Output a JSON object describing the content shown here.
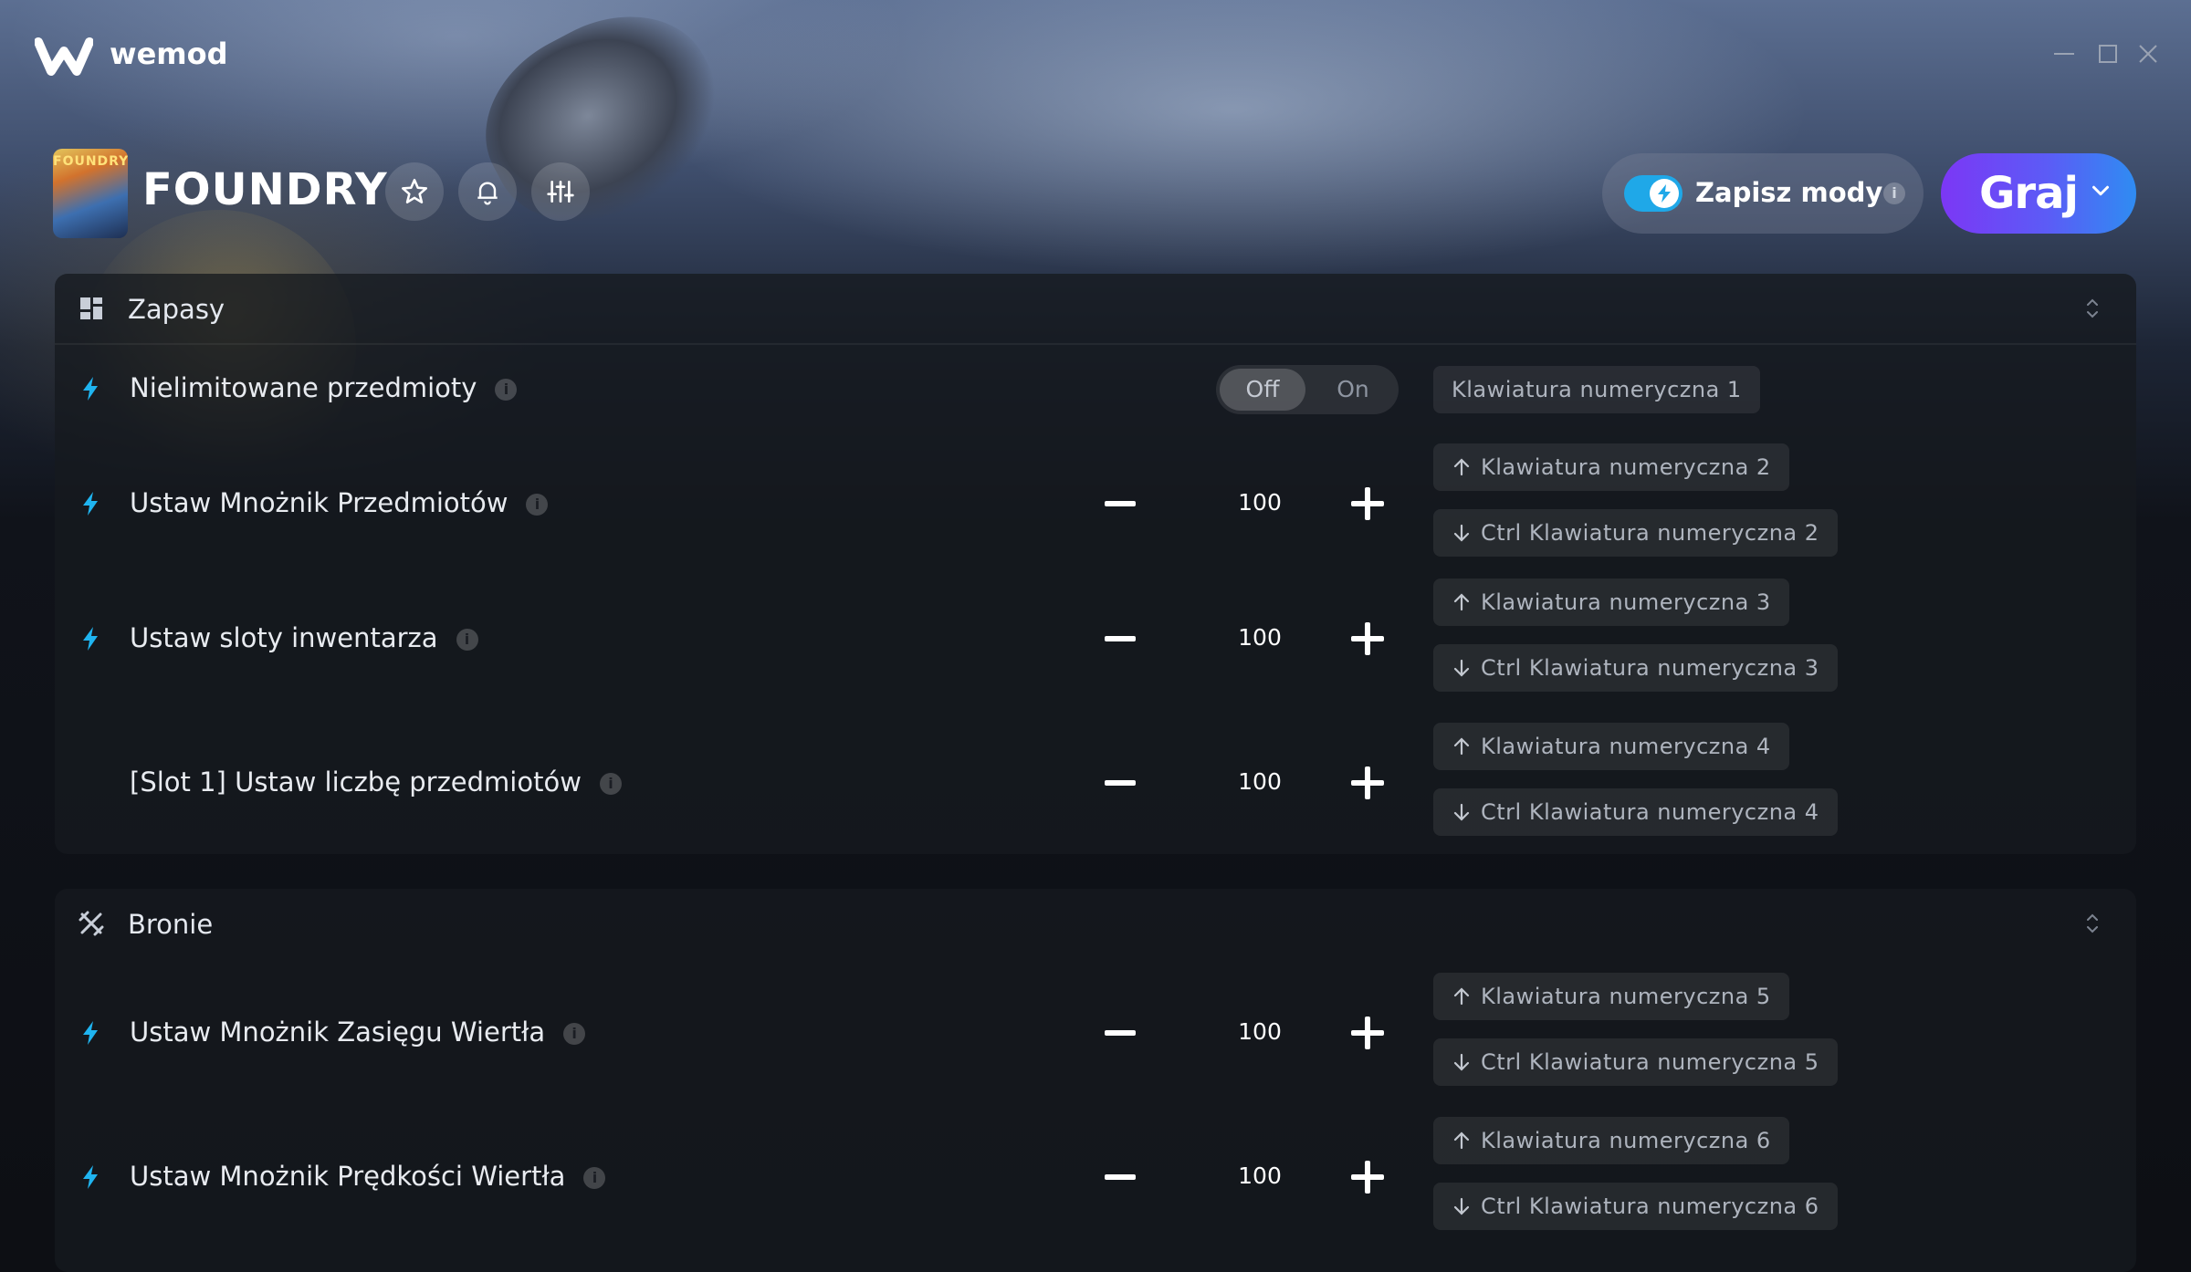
{
  "app": {
    "brand": "wemod"
  },
  "game": {
    "title": "FOUNDRY",
    "cover_text": "FOUNDRY"
  },
  "header": {
    "save_mods_label": "Zapisz mody",
    "save_info": "i",
    "play_label": "Graj"
  },
  "sections": [
    {
      "title": "Zapasy",
      "rows": [
        {
          "label": "Nielimitowane przedmioty",
          "toggle_off": "Off",
          "toggle_on": "On",
          "hotkey": "Klawiatura numeryczna 1"
        },
        {
          "label": "Ustaw Mnożnik Przedmiotów",
          "value": "100",
          "hotkey_up": "Klawiatura numeryczna 2",
          "hotkey_down": "Ctrl Klawiatura numeryczna 2"
        },
        {
          "label": "Ustaw sloty inwentarza",
          "value": "100",
          "hotkey_up": "Klawiatura numeryczna 3",
          "hotkey_down": "Ctrl Klawiatura numeryczna 3"
        },
        {
          "label": "[Slot 1] Ustaw liczbę przedmiotów",
          "value": "100",
          "hotkey_up": "Klawiatura numeryczna 4",
          "hotkey_down": "Ctrl Klawiatura numeryczna 4"
        }
      ]
    },
    {
      "title": "Bronie",
      "rows": [
        {
          "label": "Ustaw Mnożnik Zasięgu Wiertła",
          "value": "100",
          "hotkey_up": "Klawiatura numeryczna 5",
          "hotkey_down": "Ctrl Klawiatura numeryczna 5"
        },
        {
          "label": "Ustaw Mnożnik Prędkości Wiertła",
          "value": "100",
          "hotkey_up": "Klawiatura numeryczna 6",
          "hotkey_down": "Ctrl Klawiatura numeryczna 6"
        }
      ]
    }
  ],
  "colors": {
    "accent_bolt": "#1fb4f0",
    "play_gradient_start": "#7c37f5",
    "play_gradient_end": "#2f8cf2"
  }
}
